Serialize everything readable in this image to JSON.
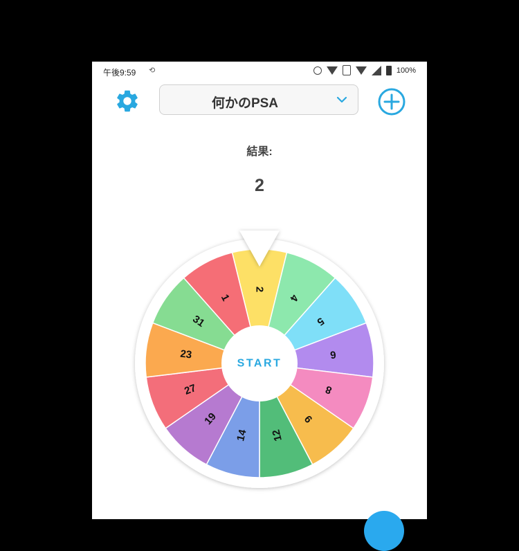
{
  "status_bar": {
    "time": "午後9:59",
    "battery": "100%"
  },
  "header": {
    "selected_wheel": "何かのPSA",
    "icons": [
      "gear-icon",
      "chevron-down-icon",
      "plus-circle-icon"
    ]
  },
  "result": {
    "label": "結果:",
    "value": "2"
  },
  "wheel": {
    "center_label": "START",
    "accent_color": "#29a8e0",
    "segments": [
      {
        "label": "2",
        "color": "#fde066"
      },
      {
        "label": "4",
        "color": "#8de8ad"
      },
      {
        "label": "5",
        "color": "#7fdff8"
      },
      {
        "label": "6",
        "color": "#b28bee"
      },
      {
        "label": "8",
        "color": "#f48bc0"
      },
      {
        "label": "9",
        "color": "#f7bc4d"
      },
      {
        "label": "12",
        "color": "#52bd79"
      },
      {
        "label": "14",
        "color": "#7b9ee8"
      },
      {
        "label": "19",
        "color": "#b67ad0"
      },
      {
        "label": "27",
        "color": "#f36e7a"
      },
      {
        "label": "23",
        "color": "#fba94f"
      },
      {
        "label": "31",
        "color": "#86dc92"
      },
      {
        "label": "1",
        "color": "#f56e76"
      }
    ]
  }
}
